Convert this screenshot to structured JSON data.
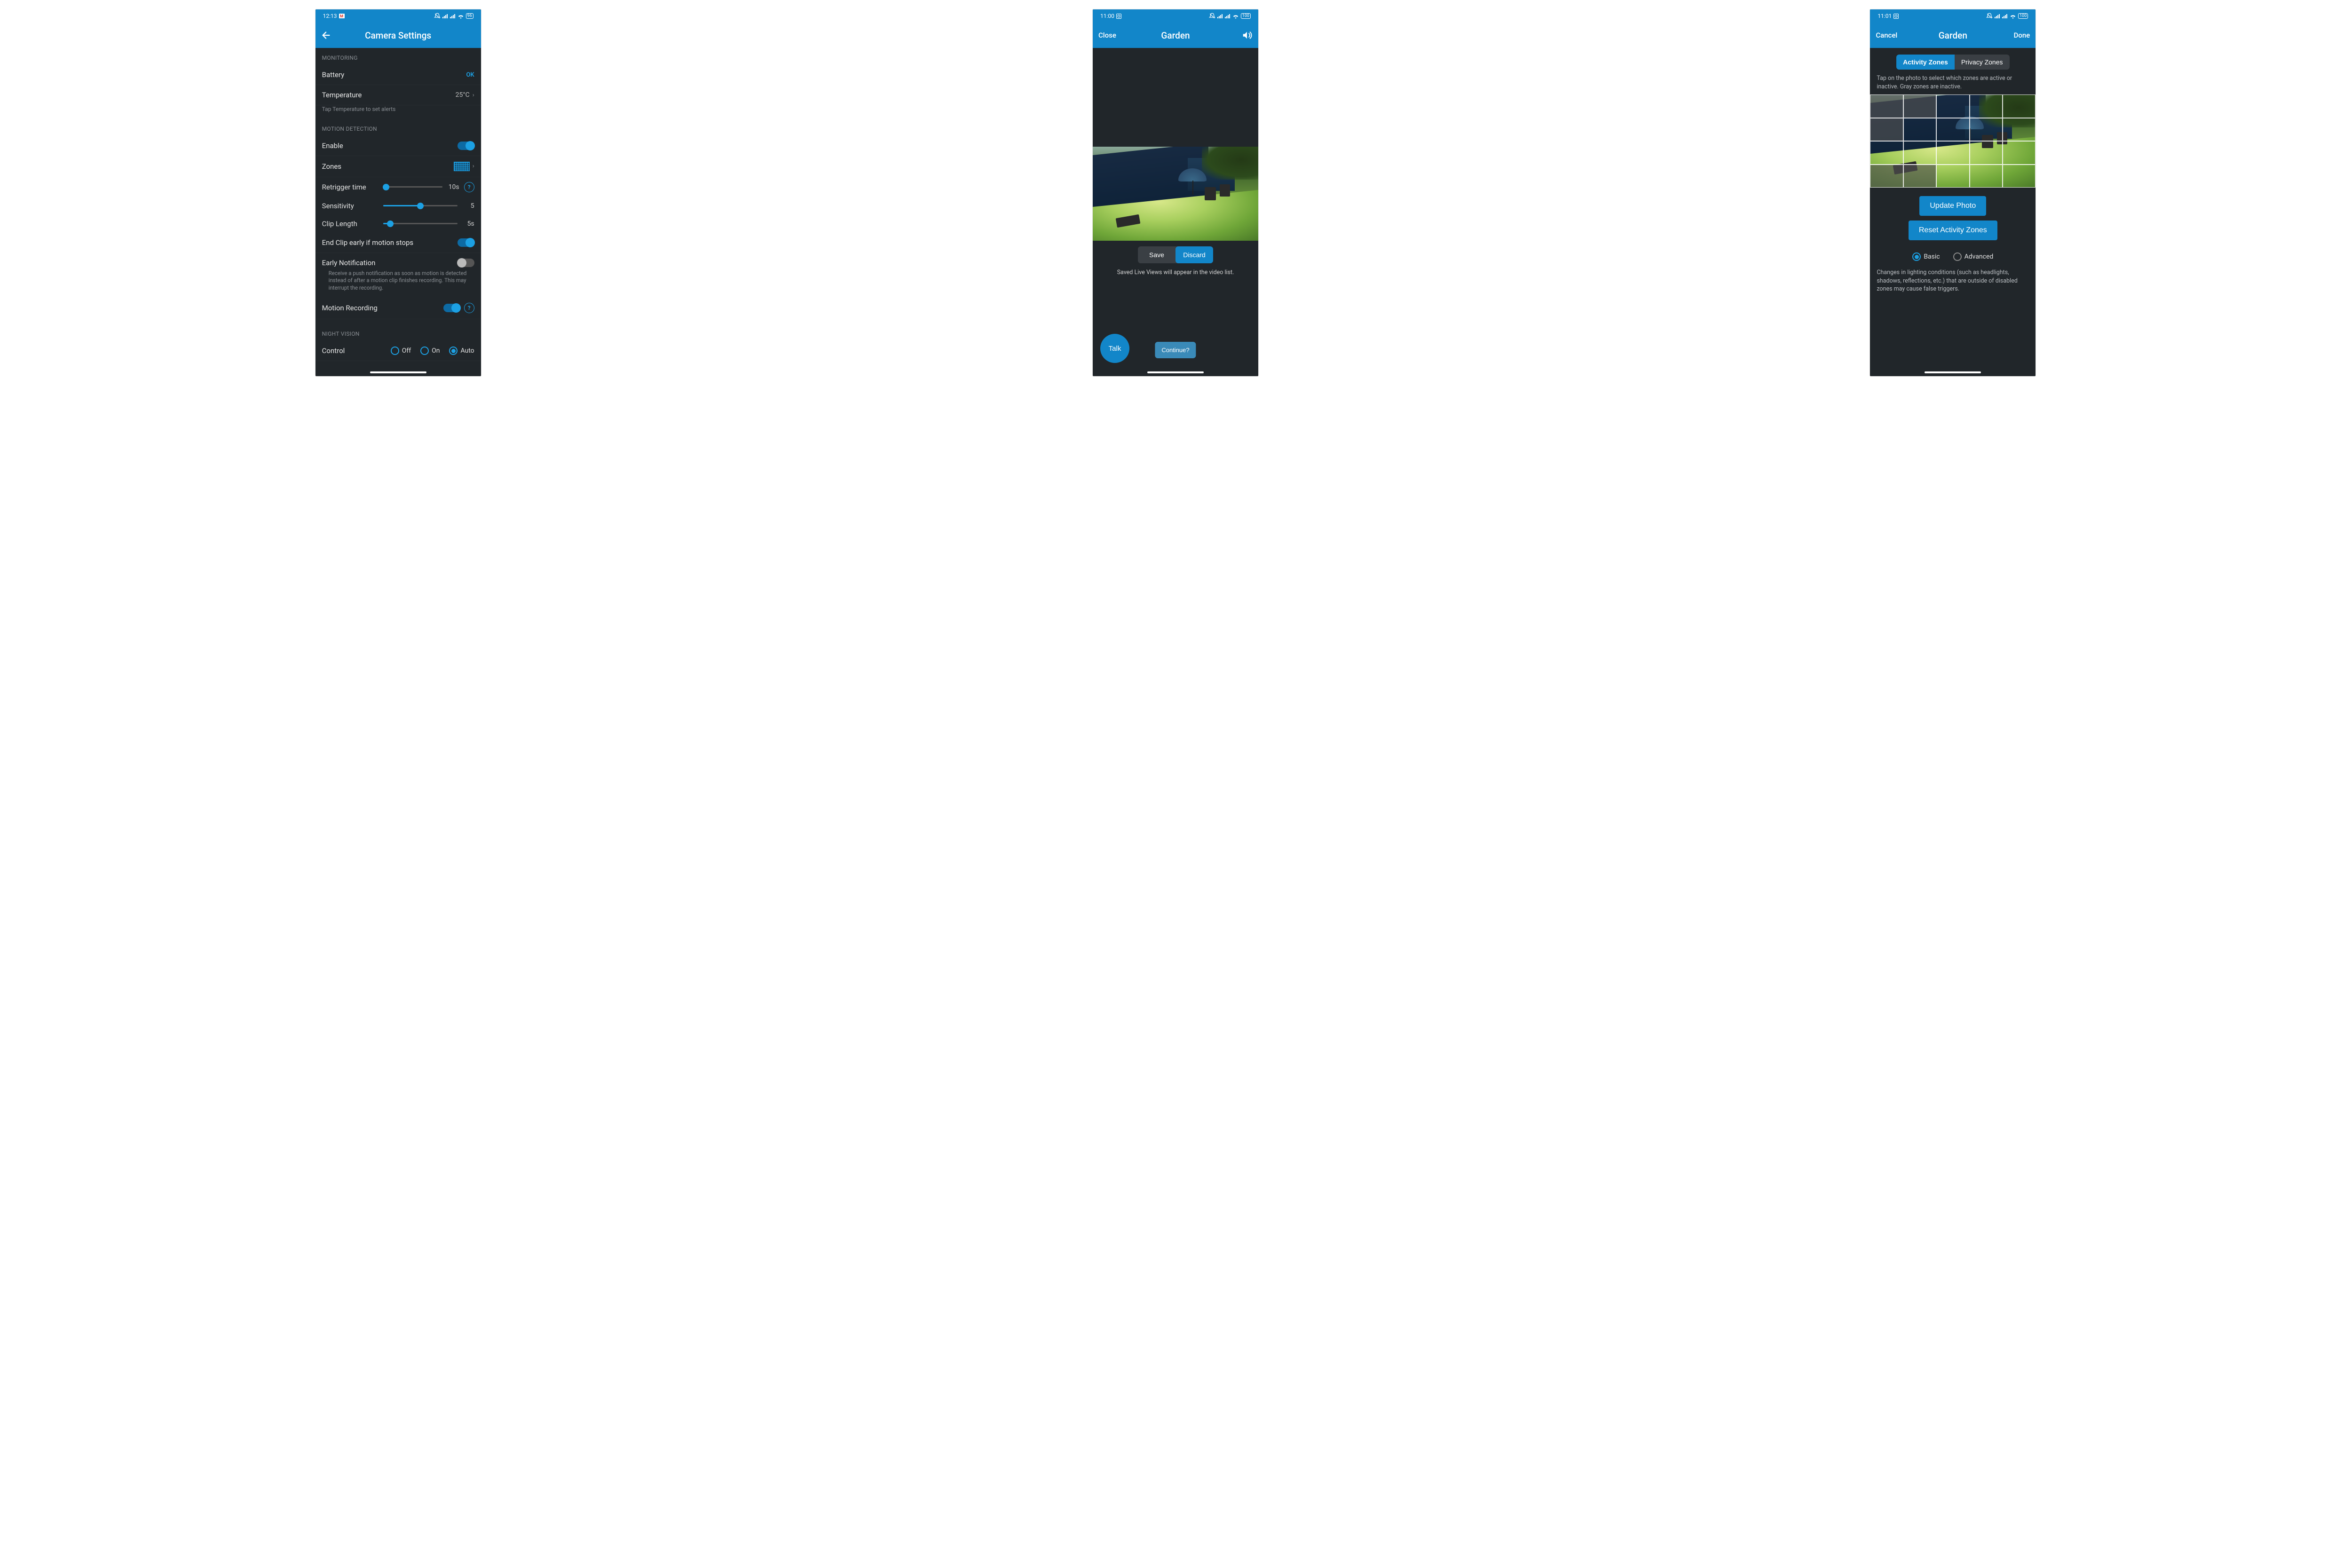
{
  "screen1": {
    "status": {
      "time": "12:13",
      "battery": "96"
    },
    "header": {
      "title": "Camera Settings"
    },
    "sections": {
      "monitoring": {
        "label": "MONITORING",
        "battery": {
          "label": "Battery",
          "value": "OK"
        },
        "temperature": {
          "label": "Temperature",
          "value": "25°C"
        },
        "hint": "Tap Temperature to set alerts"
      },
      "motion": {
        "label": "MOTION DETECTION",
        "enable": {
          "label": "Enable",
          "on": true
        },
        "zones": {
          "label": "Zones"
        },
        "retrigger": {
          "label": "Retrigger time",
          "value": "10s",
          "percent": 5
        },
        "sensitivity": {
          "label": "Sensitivity",
          "value": "5",
          "percent": 50
        },
        "clip": {
          "label": "Clip Length",
          "value": "5s",
          "percent": 10
        },
        "endclip": {
          "label": "End Clip early if motion stops",
          "on": true
        },
        "earlynotif": {
          "label": "Early Notification",
          "on": false,
          "desc": "Receive a push notification as soon as motion is detected instead of after a motion clip finishes recording. This may interrupt the recording."
        },
        "recording": {
          "label": "Motion Recording",
          "on": true
        }
      },
      "night": {
        "label": "NIGHT VISION",
        "control": {
          "label": "Control",
          "options": [
            "Off",
            "On",
            "Auto"
          ],
          "selected": "Auto"
        }
      }
    }
  },
  "screen2": {
    "status": {
      "time": "11:00",
      "battery": "100"
    },
    "header": {
      "left": "Close",
      "title": "Garden"
    },
    "seg": {
      "save": "Save",
      "discard": "Discard"
    },
    "info": "Saved Live Views will appear in the video list.",
    "talk": "Talk",
    "continue": "Continue?"
  },
  "screen3": {
    "status": {
      "time": "11:01",
      "battery": "100"
    },
    "header": {
      "left": "Cancel",
      "title": "Garden",
      "right": "Done"
    },
    "tabs": {
      "activity": "Activity Zones",
      "privacy": "Privacy Zones"
    },
    "hint": "Tap on the photo to select which zones are active or inactive. Gray zones are inactive.",
    "inactive_cells": [
      0,
      1,
      5,
      15,
      16
    ],
    "update": "Update Photo",
    "reset": "Reset Activity Zones",
    "modes": {
      "basic": "Basic",
      "advanced": "Advanced",
      "selected": "Basic"
    },
    "footer": "Changes in lighting conditions (such as headlights, shadows, reflections, etc.) that are outside of disabled zones may cause false triggers."
  }
}
